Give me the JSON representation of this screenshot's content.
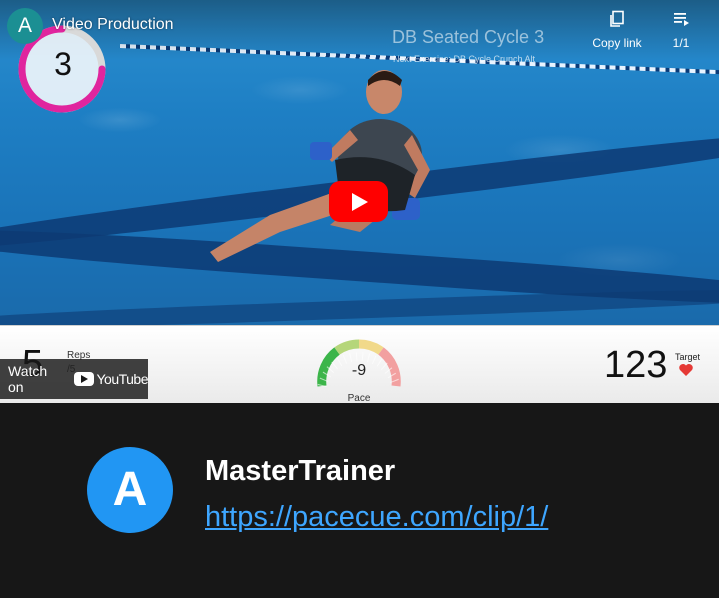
{
  "player": {
    "channel_avatar_letter": "A",
    "video_title": "Video Production",
    "counter": "3",
    "exercise_title": "DB Seated Cycle 3",
    "next_exercise": "Next Exercise: DB Cycle Crunch Alt",
    "copy_link_label": "Copy link",
    "playlist_label": "1/1",
    "watch_on_label": "Watch on",
    "youtube_label": "YouTube"
  },
  "stats": {
    "reps_value": "5",
    "reps_label": "Reps",
    "reps_sub": "/5",
    "pace_value": "-9",
    "pace_label": "Pace",
    "target_value": "123",
    "target_label": "Target"
  },
  "card": {
    "avatar_letter": "A",
    "name": "MasterTrainer",
    "link": "https://pacecue.com/clip/1/"
  },
  "icons": {
    "copy": "copy-icon",
    "playlist": "playlist-icon",
    "play": "play-icon",
    "heart": "heart-icon"
  },
  "colors": {
    "accent_red": "#ff0000",
    "link_blue": "#3ea6ff",
    "avatar_blue": "#2196f3",
    "channel_teal": "#1b8f93",
    "ring_magenta": "#e0259e"
  }
}
